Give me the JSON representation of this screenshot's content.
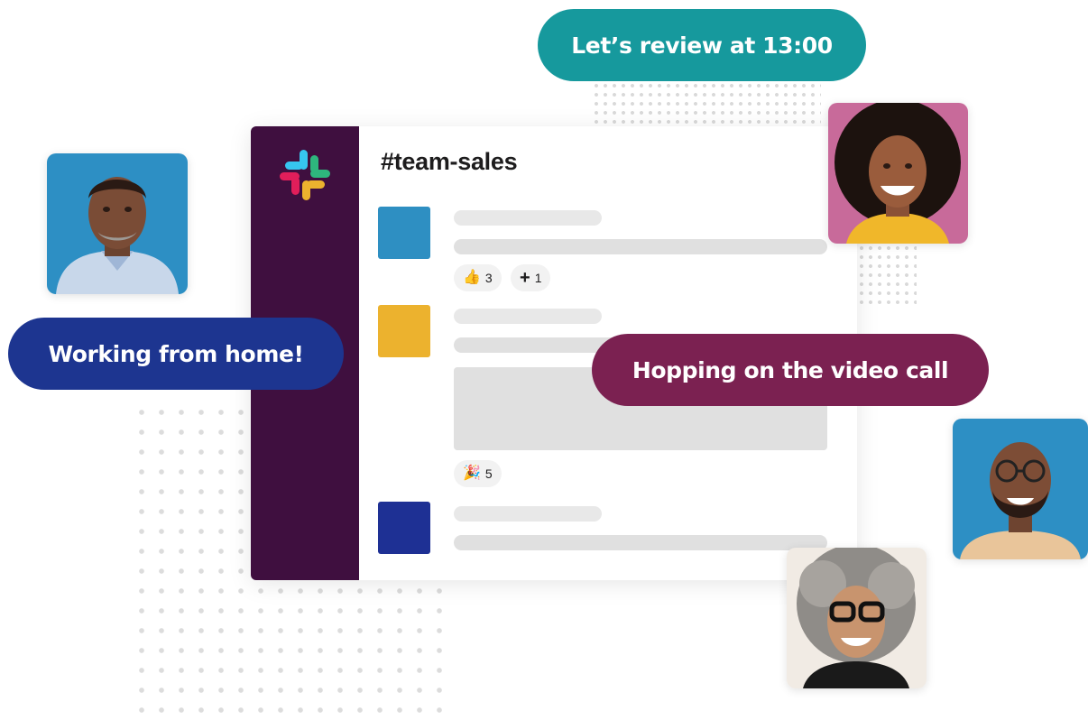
{
  "channel": {
    "name": "#team-sales"
  },
  "bubbles": {
    "review": "Let’s review at 13:00",
    "wfh": "Working from home!",
    "video_call": "Hopping on the video call"
  },
  "messages": [
    {
      "avatar_color": "#2e8fc2",
      "reactions": [
        {
          "icon": "thumbs-up-icon",
          "glyph": "👍",
          "count": "3"
        },
        {
          "icon": "add-reaction-icon",
          "glyph": "+",
          "count": "1"
        }
      ]
    },
    {
      "avatar_color": "#ecb22e",
      "has_attachment": true,
      "reactions": [
        {
          "icon": "party-popper-icon",
          "glyph": "🎉",
          "count": "5"
        }
      ]
    },
    {
      "avatar_color": "#1e3094",
      "reactions": []
    }
  ],
  "colors": {
    "sidebar": "#3f0f3f",
    "bubble_teal": "#16999d",
    "bubble_blue": "#1d3590",
    "bubble_plum": "#7b2151",
    "slack_blue": "#36c5f0",
    "slack_green": "#2eb67d",
    "slack_yellow": "#ecb22e",
    "slack_red": "#e01e5a"
  },
  "people": [
    {
      "name": "person-man-blue-shirt"
    },
    {
      "name": "person-woman-curly-hair"
    },
    {
      "name": "person-man-glasses"
    },
    {
      "name": "person-woman-grey-hair"
    }
  ]
}
